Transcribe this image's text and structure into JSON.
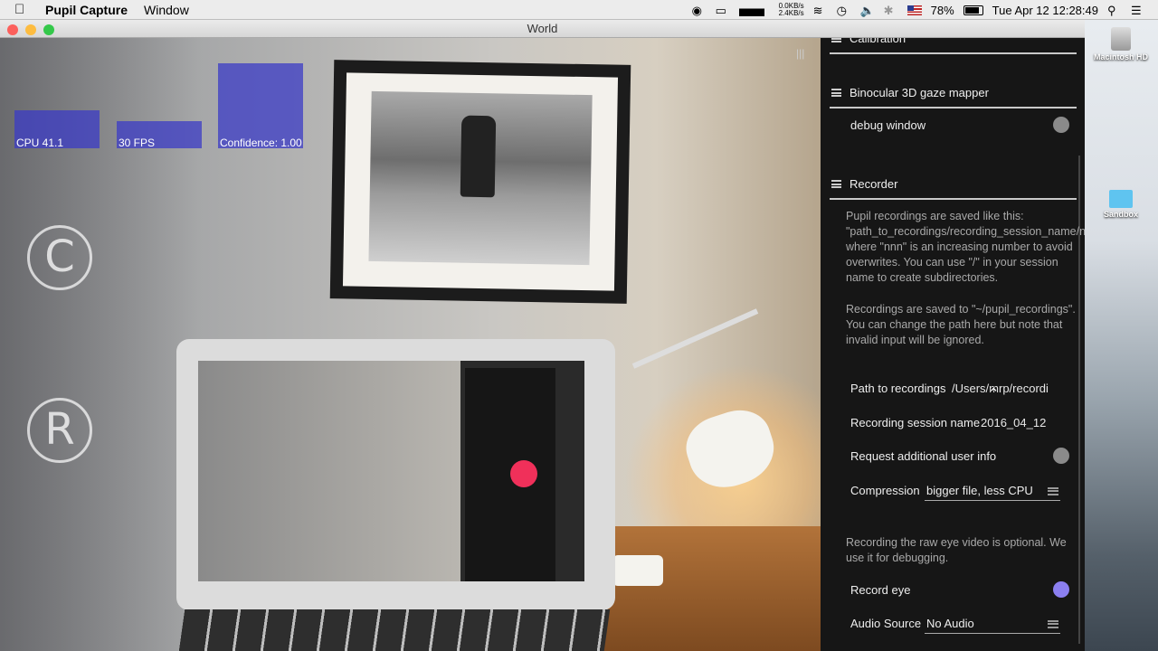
{
  "menubar": {
    "app_name": "Pupil Capture",
    "menu_window": "Window",
    "net_up": "0.0KB/s",
    "net_down": "2.4KB/s",
    "battery": "78%",
    "datetime": "Tue Apr 12  12:28:49"
  },
  "desktop": {
    "hd_label": "Macintosh HD",
    "folder_label": "Sandbox"
  },
  "window": {
    "title": "World"
  },
  "world": {
    "graphs": {
      "cpu_label": "CPU 41.1",
      "fps_label": "30 FPS",
      "confidence_label": "Confidence: 1.00",
      "cpu_level": 0.45,
      "fps_level": 0.32,
      "confidence_level": 1.0
    },
    "marker_c": "C",
    "marker_r": "R"
  },
  "sidebar": {
    "calibration_header": "Calibration",
    "gaze_mapper_header": "Binocular 3D gaze mapper",
    "debug_window_label": "debug window",
    "recorder_header": "Recorder",
    "recorder_desc_1": "Pupil recordings are saved like this: \"path_to_recordings/recording_session_name/nnn\" where \"nnn\" is an increasing number to avoid overwrites. You can use \"/\" in your session name to create subdirectories.",
    "recorder_desc_2": "Recordings are saved to \"~/pupil_recordings\". You can change the path here but note that invalid input will be ignored.",
    "path_label": "Path to recordings",
    "path_value": "/Users/mrp/recordi",
    "session_label": "Recording session name",
    "session_value": "2016_04_12",
    "user_info_label": "Request additional user info",
    "compression_label": "Compression",
    "compression_value": "bigger file, less CPU",
    "raw_eye_desc": "Recording the raw eye video is optional. We use it for debugging.",
    "record_eye_label": "Record eye",
    "audio_label": "Audio Source",
    "audio_value": "No Audio"
  }
}
